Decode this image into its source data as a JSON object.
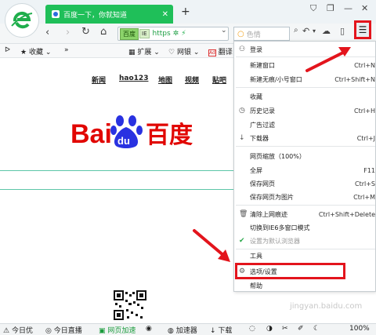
{
  "tab": {
    "title": "百度一下，你就知道"
  },
  "nav": {
    "mode": "百度",
    "url_prefix": "https",
    "search_placeholder": "色情"
  },
  "bookmarks": [
    "收藏",
    "»",
    "扩展",
    "网银",
    "翻译"
  ],
  "page": {
    "links": [
      "新闻",
      "hao123",
      "地图",
      "视频",
      "贴吧"
    ],
    "logo_text": "Bai du 百度"
  },
  "menu": {
    "items": [
      {
        "label": "登录",
        "shortcut": "",
        "icon": "user-icon"
      },
      {
        "label": "新建窗口",
        "shortcut": "Ctrl+N",
        "icon": ""
      },
      {
        "label": "新建无痕/小号窗口",
        "shortcut": "Ctrl+Shift+N",
        "icon": ""
      },
      {
        "label": "收藏",
        "shortcut": "",
        "icon": ""
      },
      {
        "label": "历史记录",
        "shortcut": "Ctrl+H",
        "icon": "clock-icon"
      },
      {
        "label": "广告过滤",
        "shortcut": "",
        "icon": ""
      },
      {
        "label": "下载器",
        "shortcut": "Ctrl+J",
        "icon": "download-icon"
      },
      {
        "label": "网页缩放（100%）",
        "shortcut": "",
        "icon": ""
      },
      {
        "label": "全屏",
        "shortcut": "F11",
        "icon": ""
      },
      {
        "label": "保存网页",
        "shortcut": "Ctrl+S",
        "icon": ""
      },
      {
        "label": "保存网页为图片",
        "shortcut": "Ctrl+M",
        "icon": ""
      },
      {
        "label": "清除上网痕迹",
        "shortcut": "Ctrl+Shift+Delete",
        "icon": "trash-icon"
      },
      {
        "label": "切换到IE6多窗口模式",
        "shortcut": "",
        "icon": ""
      },
      {
        "label": "设置为默认浏览器",
        "shortcut": "",
        "icon": "check-icon"
      },
      {
        "label": "工具",
        "shortcut": "",
        "icon": ""
      },
      {
        "label": "选项/设置",
        "shortcut": "",
        "icon": "gear-icon"
      },
      {
        "label": "帮助",
        "shortcut": "",
        "icon": ""
      }
    ]
  },
  "status": {
    "items": [
      "今日优",
      "今日直播",
      "网页加速",
      "加速器",
      "下载",
      "100%"
    ]
  },
  "watermark": "jingyan.baidu.com",
  "colors": {
    "tab": "#1fbf59",
    "highlight": "#e3141c",
    "baidu_red": "#e10602",
    "baidu_blue": "#2932e1"
  }
}
